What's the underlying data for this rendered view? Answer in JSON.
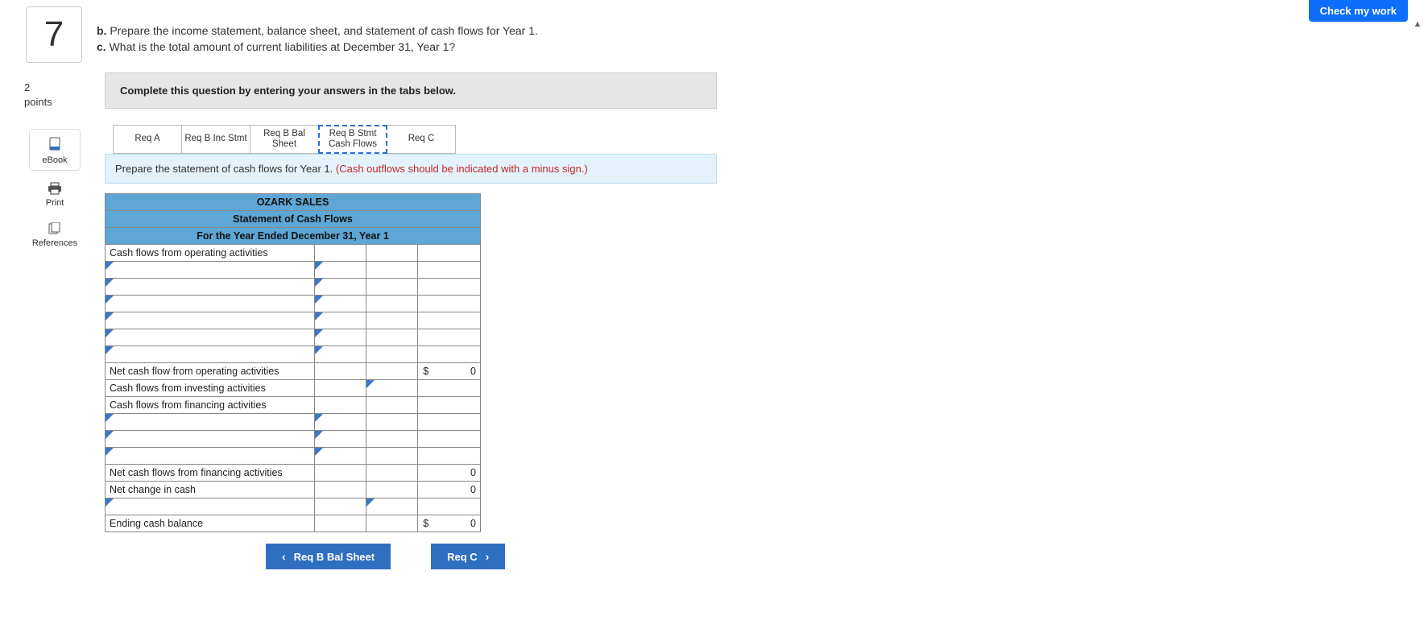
{
  "header": {
    "check_label": "Check my work"
  },
  "question": {
    "number": "7",
    "line_b_prefix": "b.",
    "line_b": "Prepare the income statement, balance sheet, and statement of cash flows for Year 1.",
    "line_c_prefix": "c.",
    "line_c": "What is the total amount of current liabilities at December 31, Year 1?",
    "points_num": "2",
    "points_label": "points"
  },
  "tools": {
    "ebook": "eBook",
    "print": "Print",
    "references": "References"
  },
  "panel": {
    "instruct": "Complete this question by entering your answers in the tabs below.",
    "tabs": {
      "a": "Req A",
      "binc": "Req B Inc Stmt",
      "bbal": "Req B Bal Sheet",
      "bcf": "Req B Stmt Cash Flows",
      "c": "Req C"
    },
    "sub_main": "Prepare the statement of cash flows for Year 1. ",
    "sub_hint": "(Cash outflows should be indicated with a minus sign.)"
  },
  "stmt": {
    "company": "OZARK SALES",
    "title": "Statement of Cash Flows",
    "period": "For the Year Ended December 31, Year 1",
    "rows": {
      "op_header": "Cash flows from operating activities",
      "net_op": "Net cash flow from operating activities",
      "inv_header": "Cash flows from investing activities",
      "fin_header": "Cash flows from financing activities",
      "net_fin": "Net cash flows from financing activities",
      "net_change": "Net change in cash",
      "ending": "Ending cash balance"
    },
    "vals": {
      "dollar": "$",
      "zero": "0"
    }
  },
  "nav": {
    "prev": "Req B Bal Sheet",
    "next": "Req C"
  }
}
